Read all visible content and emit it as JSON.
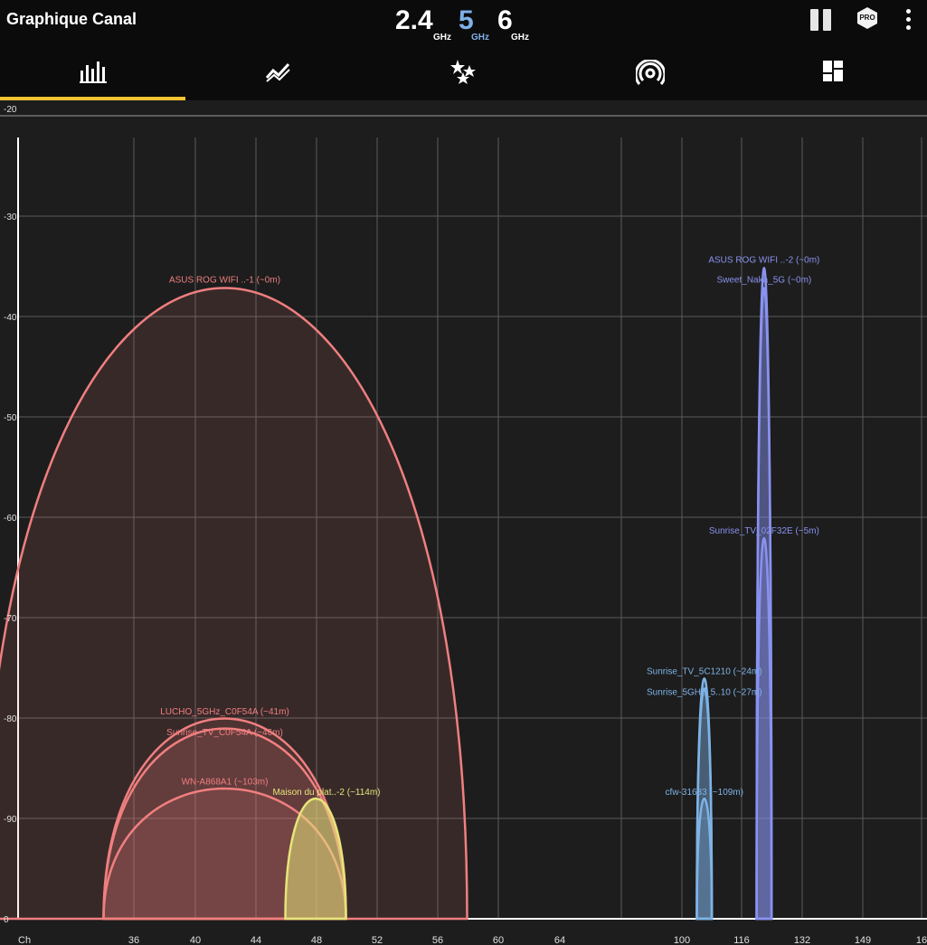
{
  "app": {
    "title": "Graphique Canal"
  },
  "bands": [
    {
      "label": "2.4",
      "unit": "GHz",
      "active": false
    },
    {
      "label": "5",
      "unit": "GHz",
      "active": true
    },
    {
      "label": "6",
      "unit": "GHz",
      "active": false
    }
  ],
  "toolbar": {
    "pro_label": "PRO",
    "icons": [
      "pause-icon",
      "pro-badge-icon",
      "more-vert-icon"
    ]
  },
  "tabs": [
    {
      "icon": "channel-graph-icon",
      "selected": true
    },
    {
      "icon": "time-graph-icon",
      "selected": false
    },
    {
      "icon": "channel-rating-icon",
      "selected": false
    },
    {
      "icon": "access-points-icon",
      "selected": false
    },
    {
      "icon": "dashboard-icon",
      "selected": false
    }
  ],
  "colors": {
    "accent": "#f4c430",
    "active_band": "#7fb0e8",
    "red": "#f07f7f",
    "yellow": "#e5e57a",
    "blue": "#8a92f0",
    "lightblue": "#7fb3e6"
  },
  "chart_data": {
    "type": "area",
    "y_ticks": [
      "-20",
      "-30",
      "-40",
      "-50",
      "-60",
      "-70",
      "-80",
      "-90",
      "0"
    ],
    "x_axis_label": "Ch",
    "x_ticks": [
      "36",
      "40",
      "44",
      "48",
      "52",
      "56",
      "60",
      "64",
      "100",
      "116",
      "132",
      "149",
      "16"
    ],
    "ylim": [
      -100,
      -20
    ],
    "series": [
      {
        "name": "ASUS ROG WIFI ..-1 (~0m)",
        "center": 42,
        "width_mhz": 160,
        "level": -37,
        "color": "red"
      },
      {
        "name": "LUCHO_5GHz_C0F54A (~41m)",
        "center": 42,
        "width_mhz": 80,
        "level": -80,
        "color": "red"
      },
      {
        "name": "Sunrise_TV_C0F54A (~46m)",
        "center": 42,
        "width_mhz": 80,
        "level": -81,
        "color": "red"
      },
      {
        "name": "WN-A868A1 (~103m)",
        "center": 42,
        "width_mhz": 80,
        "level": -87,
        "color": "red"
      },
      {
        "name": "Maison du plat..-2 (~114m)",
        "center": 48,
        "width_mhz": 20,
        "level": -88,
        "color": "yellow"
      },
      {
        "name": "ASUS ROG WIFI ..-2 (~0m)",
        "center": 122,
        "width_mhz": 20,
        "level": -35,
        "color": "blue"
      },
      {
        "name": "Sweet_Naka_5G (~0m)",
        "center": 122,
        "width_mhz": 20,
        "level": -37,
        "color": "blue"
      },
      {
        "name": "Sunrise_TV_02F32E (~5m)",
        "center": 122,
        "width_mhz": 20,
        "level": -62,
        "color": "blue"
      },
      {
        "name": "Sunrise_TV_5C1210 (~24m)",
        "center": 106,
        "width_mhz": 20,
        "level": -76,
        "color": "lightblue"
      },
      {
        "name": "Sunrise_5GHz_5..10 (~27m)",
        "center": 106,
        "width_mhz": 20,
        "level": -77,
        "color": "lightblue"
      },
      {
        "name": "cfw-31633 (~109m)",
        "center": 106,
        "width_mhz": 20,
        "level": -88,
        "color": "lightblue"
      }
    ]
  }
}
